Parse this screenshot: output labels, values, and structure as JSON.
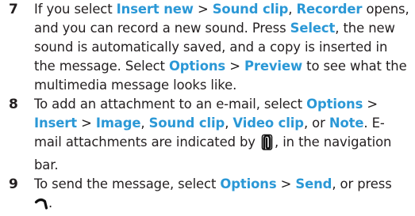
{
  "steps": [
    {
      "number": "7",
      "parts": [
        "If you select ",
        "Insert new",
        " > ",
        "Sound clip",
        ", ",
        "Recorder",
        " opens, and you can record a new sound. Press ",
        "Select",
        ", the new sound is automatically saved, and a copy is inserted in the message. Select ",
        "Options",
        " > ",
        "Preview",
        " to see what the multimedia message looks like."
      ]
    },
    {
      "number": "8",
      "parts": [
        "To add an attachment to an e-mail, select ",
        "Options",
        " > ",
        "Insert",
        " > ",
        "Image",
        ", ",
        "Sound clip",
        ", ",
        "Video clip",
        ", or ",
        "Note",
        ". E-mail attachments are indicated by ",
        ", in the navigation bar."
      ],
      "icon": "paperclip-icon"
    },
    {
      "number": "9",
      "parts": [
        "To send the message, select ",
        "Options",
        " > ",
        "Send",
        ", or press ",
        "."
      ],
      "icon": "send-key-icon"
    }
  ],
  "colors": {
    "text": "#231f20",
    "highlight": "#2b98d6"
  }
}
